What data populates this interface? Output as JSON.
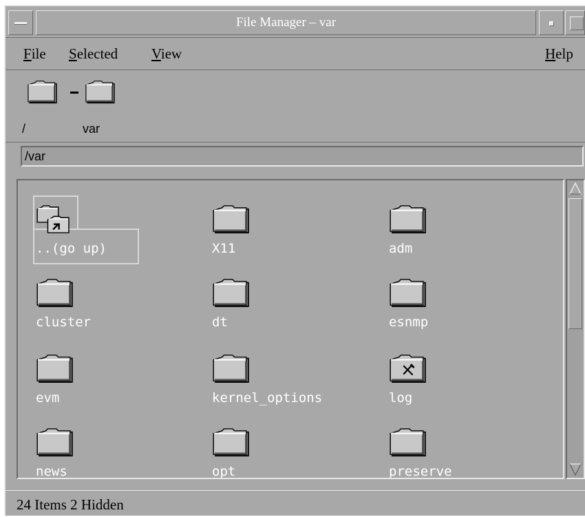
{
  "window": {
    "title": "File Manager – var"
  },
  "menu": {
    "file": "File",
    "selected": "Selected",
    "view": "View",
    "help": "Help"
  },
  "breadcrumb": {
    "root_label": "/",
    "current_label": "var"
  },
  "path_field": {
    "value": "/var"
  },
  "items": [
    {
      "name": "..(go up)",
      "icon": "go-up-folder-icon"
    },
    {
      "name": "X11",
      "icon": "folder-icon"
    },
    {
      "name": "adm",
      "icon": "folder-icon"
    },
    {
      "name": "cluster",
      "icon": "folder-icon"
    },
    {
      "name": "dt",
      "icon": "folder-icon"
    },
    {
      "name": "esnmp",
      "icon": "folder-icon"
    },
    {
      "name": "evm",
      "icon": "folder-icon"
    },
    {
      "name": "kernel_options",
      "icon": "folder-icon"
    },
    {
      "name": "log",
      "icon": "locked-folder-icon"
    },
    {
      "name": "news",
      "icon": "folder-icon"
    },
    {
      "name": "opt",
      "icon": "folder-icon"
    },
    {
      "name": "preserve",
      "icon": "folder-icon"
    }
  ],
  "status": {
    "text": "24 Items 2 Hidden"
  }
}
